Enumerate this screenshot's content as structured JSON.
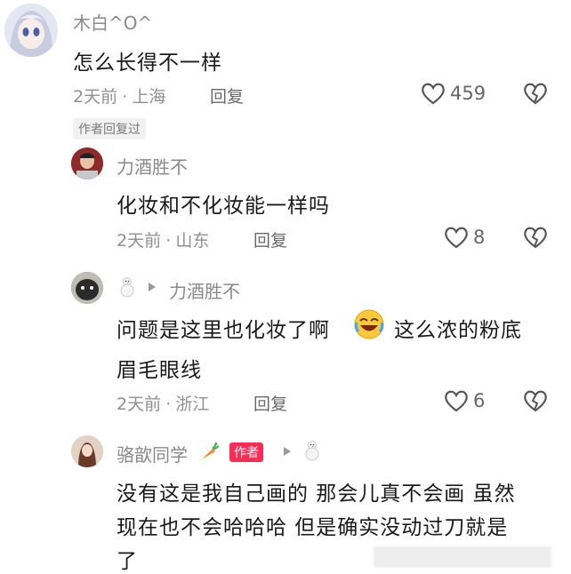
{
  "comments": [
    {
      "username": "木白^O^",
      "text": "怎么长得不一样",
      "time": "2天前",
      "location": "上海",
      "reply_label": "回复",
      "likes": "459",
      "author_replied_badge": "作者回复过"
    },
    {
      "username": "力酒胜不",
      "text": "化妆和不化妆能一样吗",
      "time": "2天前",
      "location": "山东",
      "reply_label": "回复",
      "likes": "8"
    },
    {
      "reply_to": "力酒胜不",
      "text_line1": "问题是这里也化妆了啊",
      "text_line1b": "这么浓的粉底",
      "text_line2": "眉毛眼线",
      "time": "2天前",
      "location": "浙江",
      "reply_label": "回复",
      "likes": "6"
    },
    {
      "username": "骆歆同学",
      "author_badge": "作者",
      "text_line1": "没有这是我自己画的 那会儿真不会画 虽然",
      "text_line2": "现在也不会哈哈哈 但是确实没动过刀就是",
      "text_line3": "了"
    }
  ],
  "separator": "·",
  "colors": {
    "author_badge": "#fe2c55",
    "meta_text": "#8f8f8f"
  },
  "icons": [
    "heart-icon",
    "broken-heart-icon",
    "reply-arrow-icon",
    "snowman-icon",
    "carrot-icon",
    "laughing-emoji-icon"
  ]
}
